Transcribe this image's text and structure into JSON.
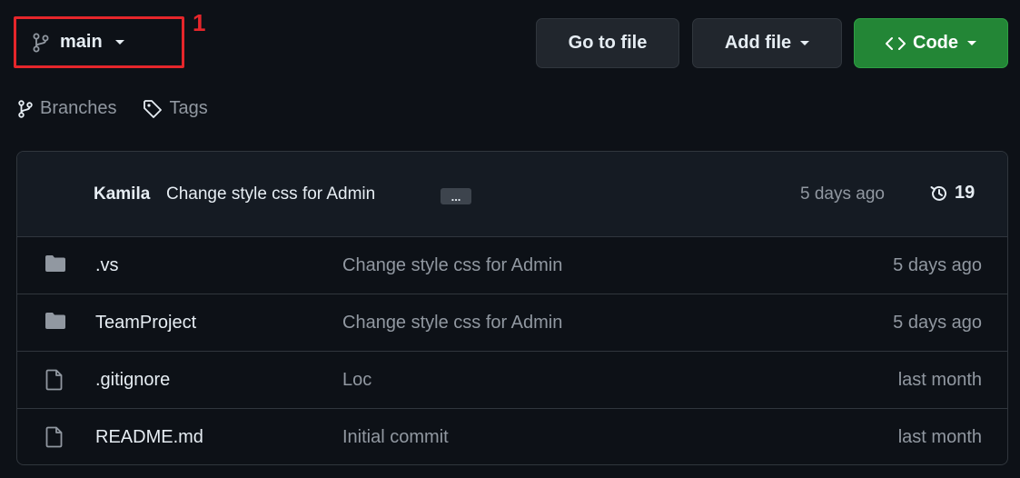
{
  "branch": {
    "name": "main"
  },
  "annotation": "1",
  "toolbar": {
    "goto_label": "Go to file",
    "addfile_label": "Add file",
    "code_label": "Code"
  },
  "meta": {
    "branches_label": "Branches",
    "tags_label": "Tags"
  },
  "latest_commit": {
    "author": "Kamila",
    "message": "Change style css for Admin",
    "ellipsis": "...",
    "time": "5 days ago",
    "commit_count": "19"
  },
  "files": [
    {
      "type": "folder",
      "name": ".vs",
      "message": "Change style css for Admin",
      "time": "5 days ago"
    },
    {
      "type": "folder",
      "name": "TeamProject",
      "message": "Change style css for Admin",
      "time": "5 days ago"
    },
    {
      "type": "file",
      "name": ".gitignore",
      "message": "Loc",
      "time": "last month"
    },
    {
      "type": "file",
      "name": "README.md",
      "message": "Initial commit",
      "time": "last month"
    }
  ],
  "colors": {
    "background": "#0d1117",
    "code_button": "#238636",
    "annotation": "#e5262b",
    "muted_text": "#9198a1"
  }
}
